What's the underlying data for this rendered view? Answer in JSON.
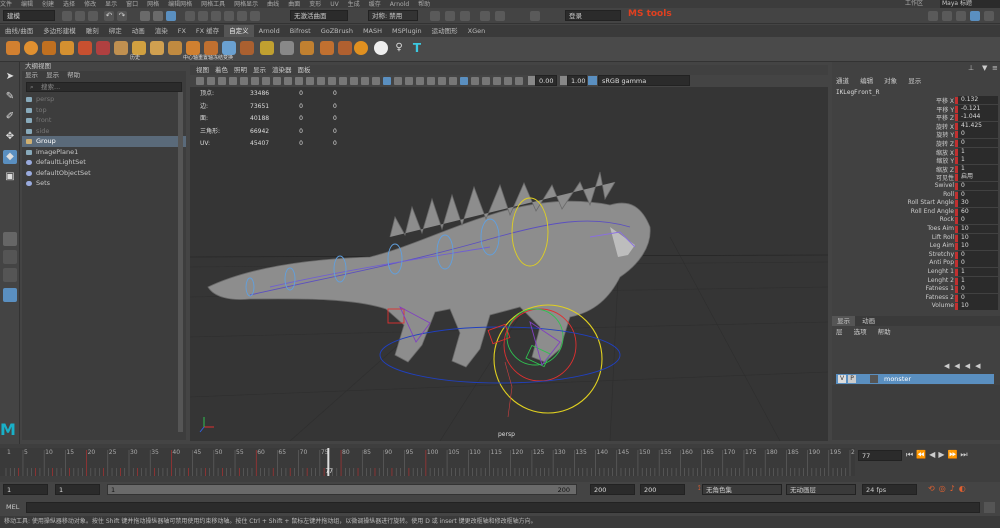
{
  "app": {
    "menus": [
      "文件",
      "编辑",
      "创建",
      "选择",
      "修改",
      "显示",
      "窗口",
      "网格",
      "编辑网格",
      "网格工具",
      "网格显示",
      "曲线",
      "曲面",
      "变形",
      "UV",
      "生成",
      "缓存",
      "Arnold",
      "帮助"
    ],
    "title_fragment": "Maya 标题",
    "workspace_field": "工作区",
    "mode": "建模"
  },
  "statusline": {
    "live_surface": "无激活曲面",
    "symmetry": "对称: 禁用",
    "login": "登录",
    "brand": "MS tools"
  },
  "shelf": {
    "tabs": [
      "曲线/曲面",
      "多边形建模",
      "雕刻",
      "绑定",
      "动画",
      "渲染",
      "FX",
      "FX 缓存",
      "自定义",
      "Arnold",
      "Bifrost",
      "GoZBrush",
      "MASH",
      "MSPlugin",
      "运动图形",
      "XGen"
    ],
    "active_tab": "自定义",
    "labels": [
      "历史",
      "中心轴",
      "重置轴",
      "冻结变换"
    ]
  },
  "outliner": {
    "title": "大纲视图",
    "menu": [
      "显示",
      "显示",
      "帮助"
    ],
    "search_placeholder": "搜索...",
    "items": [
      {
        "label": "persp",
        "dim": true,
        "icon": "camera-icon"
      },
      {
        "label": "top",
        "dim": true,
        "icon": "camera-icon"
      },
      {
        "label": "front",
        "dim": true,
        "icon": "camera-icon"
      },
      {
        "label": "side",
        "dim": true,
        "icon": "camera-icon"
      },
      {
        "label": "Group",
        "dim": false,
        "icon": "group-icon",
        "selected": true
      },
      {
        "label": "imagePlane1",
        "dim": false,
        "icon": "image-plane-icon"
      },
      {
        "label": "defaultLightSet",
        "dim": false,
        "icon": "set-icon"
      },
      {
        "label": "defaultObjectSet",
        "dim": false,
        "icon": "set-icon"
      },
      {
        "label": "Sets",
        "dim": false,
        "icon": "set-icon"
      }
    ]
  },
  "viewport": {
    "menu": [
      "视图",
      "着色",
      "照明",
      "显示",
      "渲染器",
      "面板"
    ],
    "exposure": "0.00",
    "gamma": "1.00",
    "colorspace": "sRGB gamma",
    "hud": [
      {
        "label": "顶点:",
        "a": "33486",
        "b": "0",
        "c": "0"
      },
      {
        "label": "边:",
        "a": "73651",
        "b": "0",
        "c": "0"
      },
      {
        "label": "面:",
        "a": "40188",
        "b": "0",
        "c": "0"
      },
      {
        "label": "三角形:",
        "a": "66942",
        "b": "0",
        "c": "0"
      },
      {
        "label": "UV:",
        "a": "45407",
        "b": "0",
        "c": "0"
      }
    ],
    "camera_label": "persp"
  },
  "channelbox": {
    "menu": [
      "通道",
      "编辑",
      "对象",
      "显示"
    ],
    "object_name": "IKLegFront_R",
    "attributes": [
      {
        "name": "平移 X",
        "value": "0.132"
      },
      {
        "name": "平移 Y",
        "value": "-0.121"
      },
      {
        "name": "平移 Z",
        "value": "-1.044"
      },
      {
        "name": "旋转 X",
        "value": "41.425"
      },
      {
        "name": "旋转 Y",
        "value": "0"
      },
      {
        "name": "旋转 Z",
        "value": "0"
      },
      {
        "name": "缩放 X",
        "value": "1"
      },
      {
        "name": "缩放 Y",
        "value": "1"
      },
      {
        "name": "缩放 Z",
        "value": "1"
      },
      {
        "name": "可见性",
        "value": "启用"
      },
      {
        "name": "Swivel",
        "value": "0"
      },
      {
        "name": "Roll",
        "value": "0"
      },
      {
        "name": "Roll Start Angle",
        "value": "30"
      },
      {
        "name": "Roll End Angle",
        "value": "60"
      },
      {
        "name": "Rock",
        "value": "0"
      },
      {
        "name": "Toes Aim",
        "value": "10"
      },
      {
        "name": "Lift Roll",
        "value": "10"
      },
      {
        "name": "Leg Aim",
        "value": "10"
      },
      {
        "name": "Stretchy",
        "value": "0"
      },
      {
        "name": "Anti Pop",
        "value": "0"
      },
      {
        "name": "Lenght 1",
        "value": "1"
      },
      {
        "name": "Lenght 2",
        "value": "1"
      },
      {
        "name": "Fatness 1",
        "value": "0"
      },
      {
        "name": "Fatness 2",
        "value": "0"
      },
      {
        "name": "Volume",
        "value": "10"
      }
    ]
  },
  "layers": {
    "tabs": [
      "显示",
      "动画"
    ],
    "menu": [
      "层",
      "选项",
      "帮助"
    ],
    "layer": {
      "v": "V",
      "p": "P",
      "name": "monster"
    }
  },
  "timeline": {
    "ticks": [
      "1",
      "5",
      "10",
      "15",
      "20",
      "25",
      "30",
      "35",
      "40",
      "45",
      "50",
      "55",
      "60",
      "65",
      "70",
      "75",
      "80",
      "85",
      "90",
      "95",
      "100",
      "105",
      "110",
      "115",
      "120",
      "125",
      "130",
      "135",
      "140",
      "145",
      "150",
      "155",
      "160",
      "165",
      "170",
      "175",
      "180",
      "185",
      "190",
      "195",
      "200"
    ],
    "current_frame_marker": "77",
    "current_frame": "77"
  },
  "range": {
    "start": "1",
    "start2": "1",
    "slider_start": "1",
    "slider_end": "200",
    "end": "200",
    "end2": "200",
    "character_set": "无角色集",
    "anim_layer": "无动画层",
    "fps": "24 fps"
  },
  "cmdline": {
    "label": "MEL"
  },
  "helpline": {
    "text": "移动工具: 使用操纵器移动对象。按住 Shift 键并拖动操纵器轴可禁用使用约束移动轴。按住 Ctrl + Shift + 鼠标左键并拖动组，以微调操纵器进行旋转。使用 D 或 insert 键更改枢轴和修改枢轴方向。"
  },
  "colors": {
    "accent": "#5a8fc0",
    "brand": "#e04020",
    "key_red": "#c03030"
  }
}
